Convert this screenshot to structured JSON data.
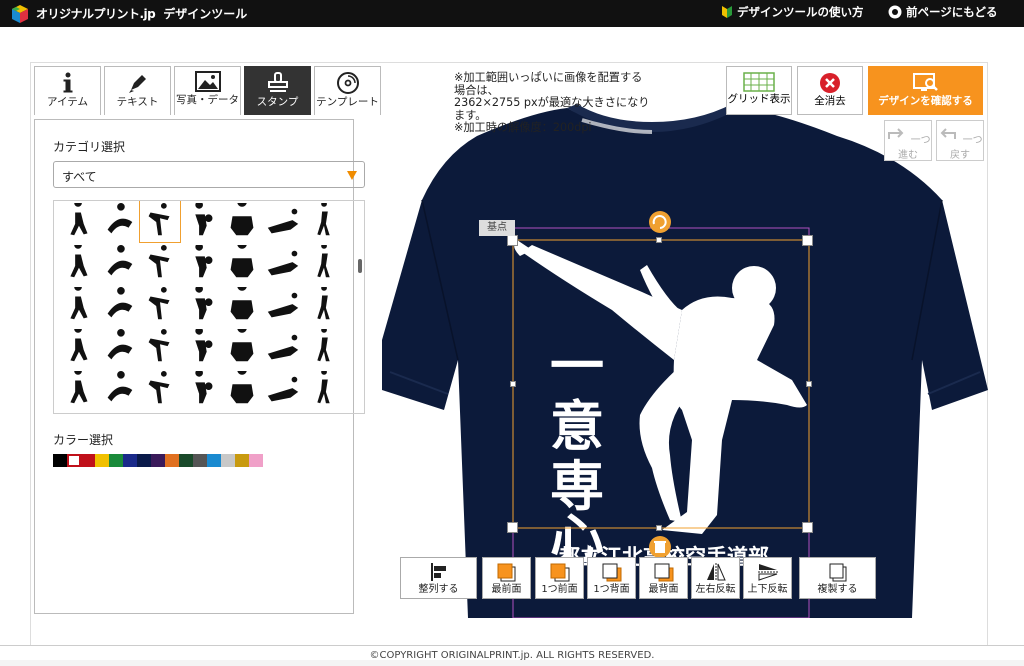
{
  "header": {
    "logo_text": "オリジナルプリント.jp",
    "app_title": "デザインツール",
    "how_to_label": "デザインツールの使い方",
    "back_label": "前ページにもどる"
  },
  "tabs": [
    {
      "label": "アイテム",
      "icon": "info-icon"
    },
    {
      "label": "テキスト",
      "icon": "pen-icon"
    },
    {
      "label": "写真・データ",
      "icon": "image-icon"
    },
    {
      "label": "スタンプ",
      "icon": "stamp-icon",
      "active": true
    },
    {
      "label": "テンプレート",
      "icon": "template-icon"
    }
  ],
  "left_panel": {
    "category_title": "カテゴリ選択",
    "category_value": "すべて",
    "color_title": "カラー選択",
    "colors": [
      "#000000",
      "#ffffff",
      "#c0101a",
      "#f0c000",
      "#1a8a3a",
      "#1a2a8a",
      "#0a1a4a",
      "#3a1a5a",
      "#e07020",
      "#1a4a2a",
      "#555555",
      "#1a8ad0",
      "#c8c8c8",
      "#c89a10",
      "#f0a0c8"
    ]
  },
  "canvas": {
    "note_lines": [
      "※加工範囲いっぱいに画像を配置する",
      "場合は、",
      "2362×2755 pxが最適な大きさになり",
      "ます。",
      "※加工時の解像度：200dpi"
    ],
    "anchor_label": "基点",
    "print_text_vertical": "一意専心",
    "print_text_bottom": "都立江北高校空手道部"
  },
  "right_buttons": {
    "grid_label": "グリッド表示",
    "clear_label": "全消去",
    "confirm_label": "デザインを確認する",
    "redo_label": "一つ進む",
    "undo_label": "一つ戻す"
  },
  "toolbar": [
    {
      "label": "整列する",
      "icon": "align-icon"
    },
    {
      "label": "最前面",
      "icon": "bring-front-icon"
    },
    {
      "label": "1つ前面",
      "icon": "bring-forward-icon"
    },
    {
      "label": "1つ背面",
      "icon": "send-backward-icon"
    },
    {
      "label": "最背面",
      "icon": "send-back-icon"
    },
    {
      "label": "左右反転",
      "icon": "flip-horizontal-icon"
    },
    {
      "label": "上下反転",
      "icon": "flip-vertical-icon"
    },
    {
      "label": "複製する",
      "icon": "duplicate-icon"
    }
  ],
  "footer": {
    "copyright": "©COPYRIGHT ORIGINALPRINT.jp. ALL RIGHTS RESERVED."
  }
}
